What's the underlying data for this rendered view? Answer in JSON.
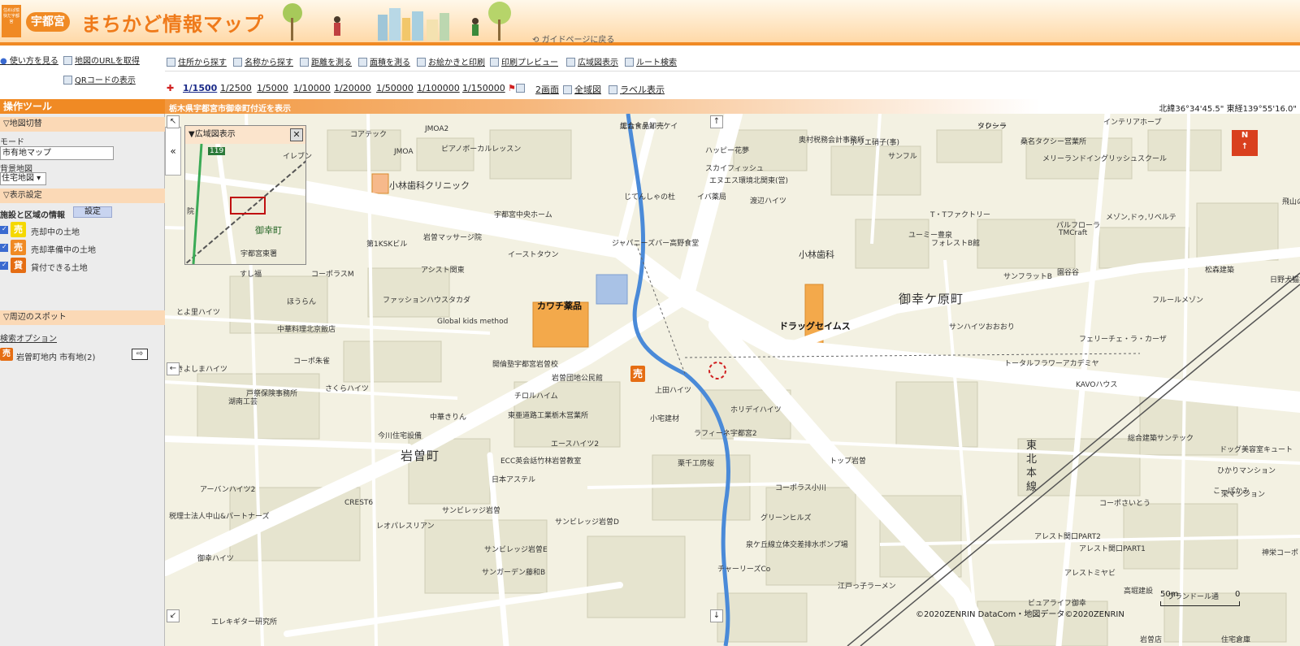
{
  "header": {
    "logo_text": "住めば愉快だ宇都宮",
    "city_badge": "宇都宮",
    "site_title": "まちかど情報マップ",
    "guide_back": "ガイドページに戻る"
  },
  "left_links": {
    "how_to_use": "使い方を見る",
    "get_url": "地図のURLを取得",
    "qr_code": "QRコードの表示"
  },
  "toolbar": {
    "items": [
      "住所から探す",
      "名称から探す",
      "距離を測る",
      "面積を測る",
      "お絵かきと印刷",
      "印刷プレビュー",
      "広域図表示",
      "ルート検索"
    ],
    "scales": [
      "1/1500",
      "1/2500",
      "1/5000",
      "1/10000",
      "1/20000",
      "1/50000",
      "1/100000",
      "1/150000"
    ],
    "active_scale": "1/1500",
    "extra": [
      "2画面",
      "全域図",
      "ラベル表示"
    ]
  },
  "status": {
    "tools_title": "操作ツール",
    "location": "栃木県宇都宮市御幸町付近を表示",
    "coords": "北緯36°34'45.5\" 東経139°55'16.0\""
  },
  "left_panel": {
    "map_switch": "▽地図切替",
    "mode_label": "モード",
    "mode_value": "市有地マップ",
    "bg_label": "背景地図",
    "bg_value": "住宅地図",
    "display_settings": "▽表示設定",
    "facility_label": "施設と区域の情報",
    "settings_button": "設定",
    "land_items": [
      {
        "label": "売却中の土地",
        "icon": "売",
        "color": "#f5d800"
      },
      {
        "label": "売却準備中の土地",
        "icon": "売",
        "color": "#f08a24"
      },
      {
        "label": "貸付できる土地",
        "icon": "貸",
        "color": "#e56d13"
      }
    ],
    "nearby_spots": "▽周辺のスポット",
    "search_options": "検索オプション",
    "result_label": "岩曽町地内 市有地(2)"
  },
  "map": {
    "overview_title": "▼広域図表示",
    "overview_labels": [
      "119",
      "イレブン",
      "御幸町",
      "宇都宮東署",
      "すし福",
      "院"
    ],
    "areas": [
      "御幸ケ原町",
      "岩曽町"
    ],
    "pois": [
      "カワチ薬品",
      "ドラッグセイムス",
      "小林歯科クリニック",
      "小林歯科"
    ],
    "rail": [
      "東",
      "北",
      "本",
      "線"
    ],
    "labels": [
      "エム・ティーケイ",
      "ソレーラ",
      "インテリアホープ",
      "奥村税務会計事務所",
      "ホリエ硝子(事)",
      "サンフル",
      "桑名タクシー営業所",
      "メリーランドイングリッシュスクール",
      "ハッピー花夢",
      "スカイフィッシュ",
      "エヌエス環境北関東(営)",
      "イバ薬局",
      "渡辺ハイツ",
      "じてんしゃの杜",
      "JMOA2",
      "JMOA",
      "ピアノボーカルレッスン",
      "コアテック",
      "宇都宮中央ホーム",
      "ジャパニーズバー高野食堂",
      "T・Tファクトリー",
      "パルフローラ",
      "ユーミー豊泉",
      "フォレストB館",
      "TMCraft",
      "メゾン,ドゥ,リベルテ",
      "松森建築",
      "サンフラットB",
      "園谷谷",
      "フルールメゾン",
      "サンハイツおおおり",
      "フェリーチェ・ラ・カーザ",
      "トータルフラワーアカデミヤ",
      "KAVOハウス",
      "岩曽マッサージ院",
      "第1KSKビル",
      "イーストタウン",
      "アシスト関東",
      "コーポラスM",
      "ファッションハウスタカダ",
      "Global kids method",
      "中華料理北京飯店",
      "とよ里ハイツ",
      "ほうらん",
      "開倫塾宇都宮岩曽校",
      "岩曽団地公民館",
      "コーポ朱雀",
      "チロルハイム",
      "きよしまハイツ",
      "さくらハイツ",
      "戸祭保険事務所",
      "湖南工芸",
      "中華きりん",
      "今川住宅設備",
      "東亜道路工業栃木営業所",
      "エースハイツ2",
      "ECC英会話竹林岩曽教室",
      "日本アステル",
      "アーバンハイツ2",
      "CREST6",
      "サンビレッジ岩曽",
      "レオパレスリアン",
      "税理士法人中山&パートナーズ",
      "サンビレッジ岩曽D",
      "サンビレッジ岩曽E",
      "サンガーデン藤和B",
      "エレキギター研究所",
      "上田ハイツ",
      "小宅建材",
      "ホリデイハイツ",
      "ラフィーネ宇都宮2",
      "栗千工房桜",
      "トップ岩曽",
      "コーポラス小川",
      "グリーンヒルズ",
      "泉ケ丘線立体交差排水ポンプ場",
      "チャーリーズCo",
      "江戸っ子ラーメン",
      "総合建築サンテック",
      "ドッグ美容室キュート",
      "ひかりマンション",
      "栄マンション",
      "コーポさいとう",
      "アレスト関口PART2",
      "アレスト関口PART1",
      "アレストミヤビ",
      "高堀建設",
      "ビュアライフ御幸",
      "プランドール通",
      "日野犬猫病院",
      "飛山の里",
      "こーぽかみ",
      "神栄コーポ",
      "御幸ハイツ",
      "住宅倉庫",
      "岩曽店",
      "総合食品卸売",
      "タクシー"
    ],
    "scale_text": "50m",
    "scale_zero": "0",
    "copyright": "©2020ZENRIN DataCom・地図データ©2020ZENRIN",
    "compass": "N",
    "sale_marker": "売"
  }
}
